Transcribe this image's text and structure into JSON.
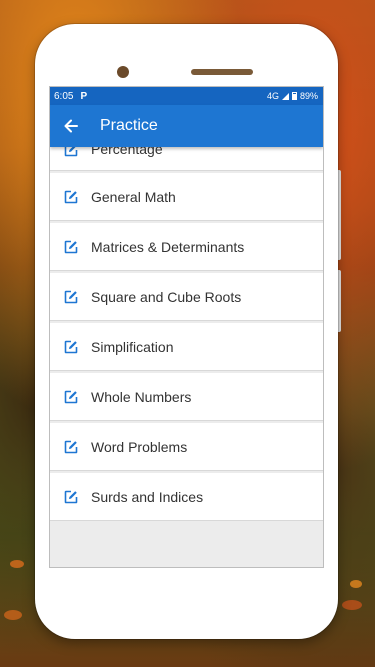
{
  "status": {
    "time": "6:05",
    "app_badge": "P",
    "network": "4G",
    "battery": "89%"
  },
  "appbar": {
    "title": "Practice",
    "back_icon": "arrow-back-icon"
  },
  "topics": [
    {
      "label": "Percentage",
      "icon": "edit-square-icon"
    },
    {
      "label": "General Math",
      "icon": "edit-square-icon"
    },
    {
      "label": "Matrices & Determinants",
      "icon": "edit-square-icon"
    },
    {
      "label": "Square and Cube Roots",
      "icon": "edit-square-icon"
    },
    {
      "label": "Simplification",
      "icon": "edit-square-icon"
    },
    {
      "label": "Whole Numbers",
      "icon": "edit-square-icon"
    },
    {
      "label": "Word Problems",
      "icon": "edit-square-icon"
    },
    {
      "label": "Surds and Indices",
      "icon": "edit-square-icon"
    }
  ],
  "colors": {
    "primary": "#1e76d2",
    "statusbar": "#1565c0",
    "icon": "#1e76d2"
  }
}
